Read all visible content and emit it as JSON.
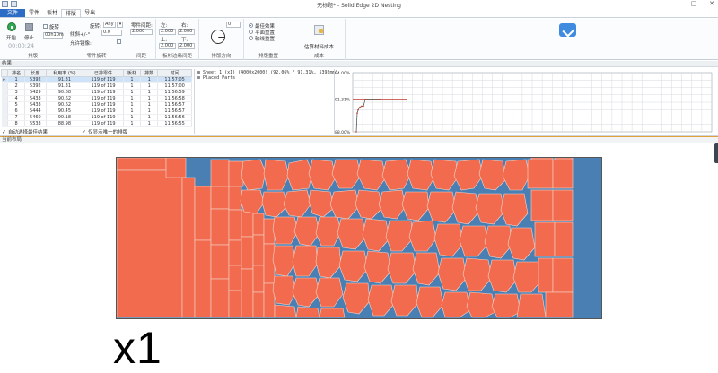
{
  "titlebar": {
    "title": "无标题* - Solid Edge 2D Nesting",
    "minimize": "—",
    "maximize": "▢",
    "close": "✕"
  },
  "tabs": [
    "文件",
    "零件",
    "板材",
    "排版",
    "导出"
  ],
  "ribbon": {
    "run": {
      "start_label": "开始",
      "stop_label": "停止",
      "timer": "00:00:24",
      "caption": "排版",
      "rotate_label": "旋转",
      "rotate_value": "00h10m"
    },
    "part_rotation": {
      "rotation_label": "旋转:",
      "rotation_value": "Any",
      "tilt_label": "倾斜+/-°",
      "tilt_value": "0.0",
      "mirror_label": "允许镜像:",
      "caption": "零件旋转"
    },
    "clearance": {
      "label": "零件间距:",
      "value": "2.000",
      "caption": "间距"
    },
    "margins": {
      "left_label": "左:",
      "left_value": "2.000",
      "right_label": "右:",
      "right_value": "2.000",
      "top_label": "上:",
      "top_value": "2.000",
      "bottom_label": "下:",
      "bottom_value": "2.000",
      "caption": "板材边缘间距"
    },
    "direction": {
      "value": "0",
      "caption": "排版方向"
    },
    "priority": {
      "option1": "最佳效果",
      "option2": "平面重置",
      "option3": "轴线重置",
      "caption": "排版重置"
    },
    "cost": {
      "label": "估算材料成本",
      "caption": "成本"
    }
  },
  "results": {
    "section_title": "结果",
    "columns": [
      "排名",
      "长度",
      "利用率 (%)",
      "已排零件",
      "板材",
      "排数",
      "时间"
    ],
    "rows": [
      [
        "1",
        "5392",
        "91.31",
        "119 of 119",
        "1",
        "1",
        "11:57:05"
      ],
      [
        "2",
        "5392",
        "91.31",
        "119 of 119",
        "1",
        "1",
        "11:57:00"
      ],
      [
        "3",
        "5429",
        "90.68",
        "119 of 119",
        "1",
        "1",
        "11:56:59"
      ],
      [
        "4",
        "5433",
        "90.62",
        "119 of 119",
        "1",
        "1",
        "11:56:58"
      ],
      [
        "5",
        "5433",
        "90.62",
        "119 of 119",
        "1",
        "1",
        "11:56:57"
      ],
      [
        "6",
        "5444",
        "90.45",
        "119 of 119",
        "1",
        "1",
        "11:56:57"
      ],
      [
        "7",
        "5460",
        "90.18",
        "119 of 119",
        "1",
        "1",
        "11:56:56"
      ],
      [
        "8",
        "5533",
        "88.98",
        "119 of 119",
        "1",
        "1",
        "11:56:55"
      ]
    ],
    "auto_select_label": "自动选择最佳结果",
    "unique_only_label": "仅显示唯一的排版",
    "tree": [
      "⊞ Sheet 1 (x1)  (4000x2000)  (92.06% / 91.31%, 5392mm)",
      "⊞ Placed Parts"
    ]
  },
  "chart_data": {
    "type": "line",
    "y_tick_labels": [
      "94.00%",
      "91.31%",
      "88.00%"
    ],
    "ylim": [
      88.0,
      94.0
    ],
    "series": [
      {
        "values": [
          88.0,
          89.9,
          90.2,
          90.5,
          90.6,
          90.6,
          91.3,
          91.3
        ]
      }
    ],
    "grid": true
  },
  "layout": {
    "section_title": "当前布局",
    "multiplier": "x1"
  },
  "colors": {
    "part": "#f26b4f",
    "sheet": "#4a7fb4",
    "accent": "#2b6cc4"
  }
}
